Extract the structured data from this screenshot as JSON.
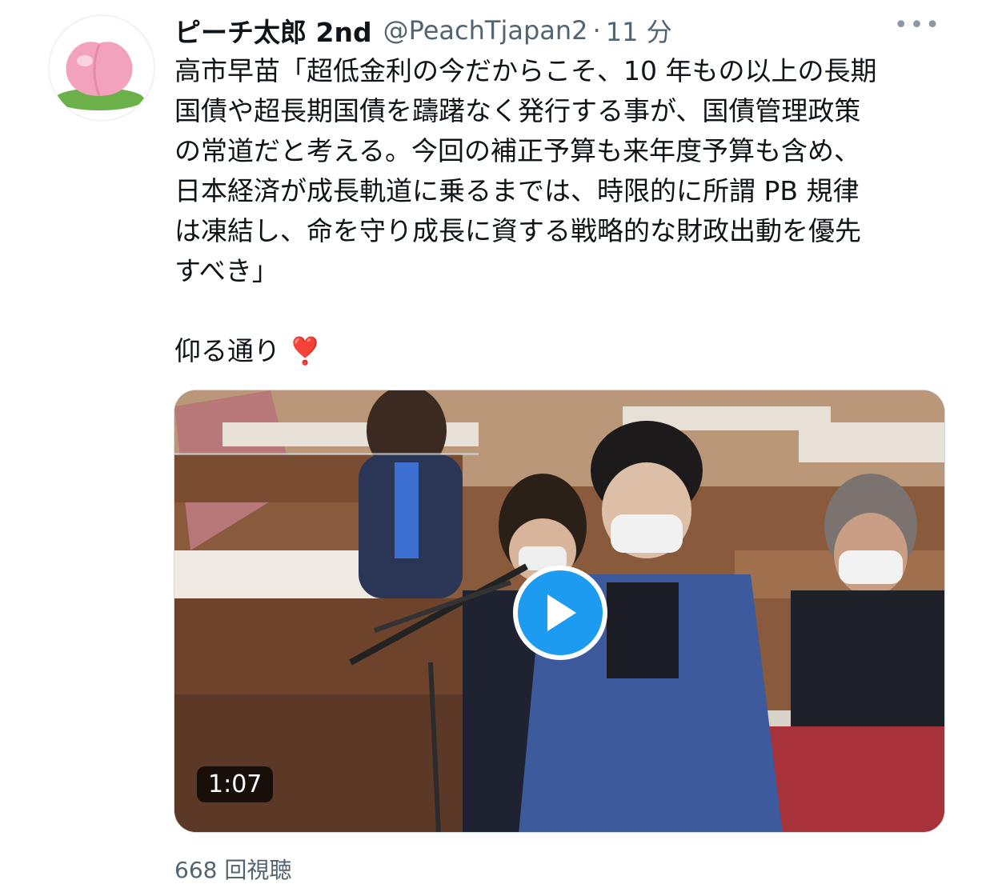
{
  "tweet": {
    "display_name": "ピーチ太郎 2nd",
    "handle": "@PeachTjapan2",
    "separator": "·",
    "time": "11 分",
    "more_icon": "•••",
    "text_lines": [
      "高市早苗「超低金利の今だからこそ、10 年もの以上の長期",
      "国債や超長期国債を躊躇なく発行する事が、国債管理政策",
      "の常道だと考える。今回の補正予算も来年度予算も含め、",
      "日本経済が成長軌道に乗るまでは、時限的に所謂 PB 規律",
      "は凍結し、命を守り成長に資する戦略的な財政出動を優先",
      "すべき」"
    ],
    "closing_text": "仰る通り",
    "closing_emoji": "❣️",
    "video": {
      "duration": "1:07",
      "play_icon": "play-icon"
    },
    "view_count": "668 回視聴"
  },
  "colors": {
    "accent": "#1d9bf0",
    "secondary_text": "#536471",
    "primary_text": "#0f1419"
  }
}
